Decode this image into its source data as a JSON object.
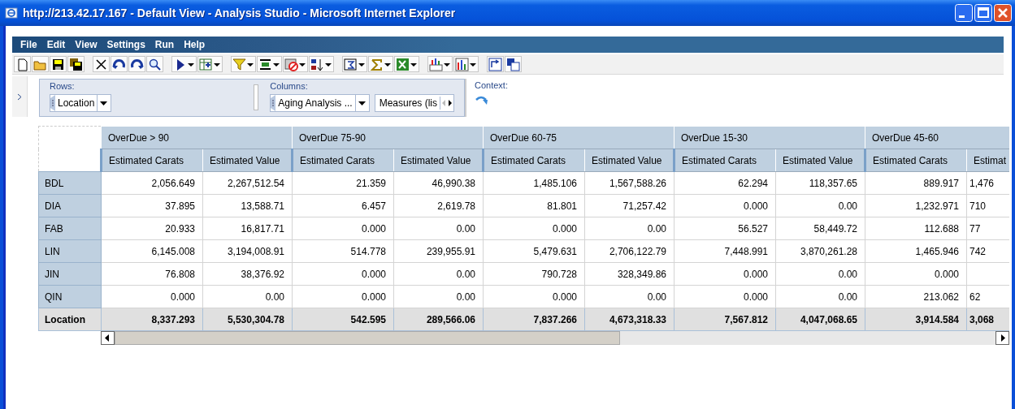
{
  "window": {
    "title": "http://213.42.17.167 - Default View - Analysis Studio - Microsoft Internet Explorer"
  },
  "menu": [
    "File",
    "Edit",
    "View",
    "Settings",
    "Run",
    "Help"
  ],
  "pivot": {
    "rows_label": "Rows:",
    "rows_items": [
      "Location"
    ],
    "columns_label": "Columns:",
    "columns_items": [
      "Aging Analysis ...",
      "Measures (lis"
    ],
    "context_label": "Context:"
  },
  "table": {
    "column_groups": [
      {
        "label": "OverDue > 90",
        "columns": [
          "Estimated Carats",
          "Estimated Value"
        ]
      },
      {
        "label": "OverDue 75-90",
        "columns": [
          "Estimated Carats",
          "Estimated Value"
        ]
      },
      {
        "label": "OverDue 60-75",
        "columns": [
          "Estimated Carats",
          "Estimated Value"
        ]
      },
      {
        "label": "OverDue 15-30",
        "columns": [
          "Estimated Carats",
          "Estimated Value"
        ]
      },
      {
        "label": "OverDue 45-60",
        "columns": [
          "Estimated Carats",
          "Estimat"
        ]
      }
    ],
    "rows": [
      {
        "label": "BDL",
        "values": [
          "2,056.649",
          "2,267,512.54",
          "21.359",
          "46,990.38",
          "1,485.106",
          "1,567,588.26",
          "62.294",
          "118,357.65",
          "889.917",
          "1,476"
        ]
      },
      {
        "label": "DIA",
        "values": [
          "37.895",
          "13,588.71",
          "6.457",
          "2,619.78",
          "81.801",
          "71,257.42",
          "0.000",
          "0.00",
          "1,232.971",
          "710"
        ]
      },
      {
        "label": "FAB",
        "values": [
          "20.933",
          "16,817.71",
          "0.000",
          "0.00",
          "0.000",
          "0.00",
          "56.527",
          "58,449.72",
          "112.688",
          "77"
        ]
      },
      {
        "label": "LIN",
        "values": [
          "6,145.008",
          "3,194,008.91",
          "514.778",
          "239,955.91",
          "5,479.631",
          "2,706,122.79",
          "7,448.991",
          "3,870,261.28",
          "1,465.946",
          "742"
        ]
      },
      {
        "label": "JIN",
        "values": [
          "76.808",
          "38,376.92",
          "0.000",
          "0.00",
          "790.728",
          "328,349.86",
          "0.000",
          "0.00",
          "0.000"
        ]
      },
      {
        "label": "QIN",
        "values": [
          "0.000",
          "0.00",
          "0.000",
          "0.00",
          "0.000",
          "0.00",
          "0.000",
          "0.00",
          "213.062",
          "62"
        ]
      }
    ],
    "total": {
      "label": "Location",
      "values": [
        "8,337.293",
        "5,530,304.78",
        "542.595",
        "289,566.06",
        "7,837.266",
        "4,673,318.33",
        "7,567.812",
        "4,047,068.65",
        "3,914.584",
        "3,068"
      ]
    }
  }
}
